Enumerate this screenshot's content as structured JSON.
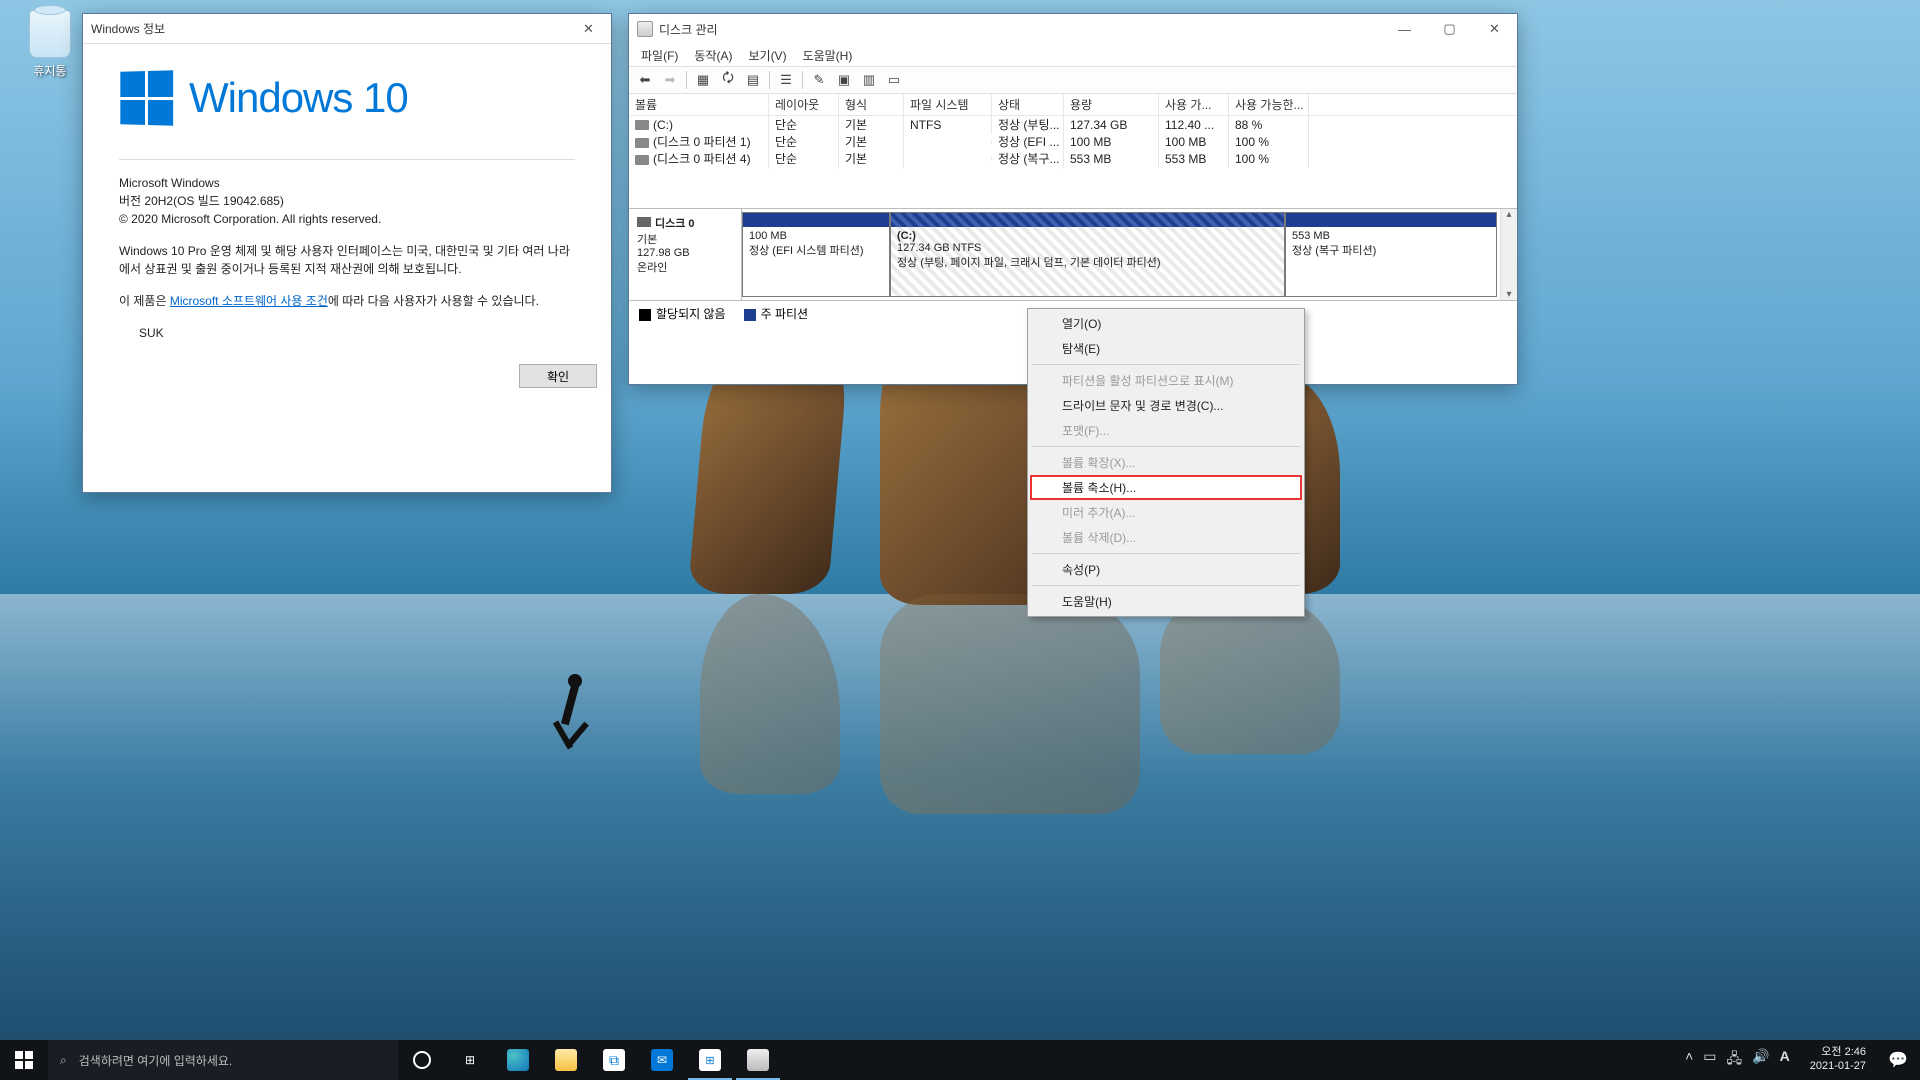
{
  "desktop": {
    "recycle_bin": "휴지통"
  },
  "winver": {
    "title": "Windows 정보",
    "logo_text": "Windows 10",
    "heading": "Microsoft Windows",
    "version": "버전 20H2(OS 빌드 19042.685)",
    "copyright": "© 2020 Microsoft Corporation. All rights reserved.",
    "para2": "Windows 10 Pro 운영 체제 및 해당 사용자 인터페이스는 미국, 대한민국 및 기타 여러 나라에서 상표권 및 출원 중이거나 등록된 지적 재산권에 의해 보호됩니다.",
    "para3_pre": "이 제품은 ",
    "para3_link": "Microsoft 소프트웨어 사용 조건",
    "para3_post": "에 따라 다음 사용자가 사용할 수 있습니다.",
    "user": "SUK",
    "ok": "확인"
  },
  "diskmgmt": {
    "title": "디스크 관리",
    "menus": [
      "파일(F)",
      "동작(A)",
      "보기(V)",
      "도움말(H)"
    ],
    "columns": {
      "vol": "볼륨",
      "layout": "레이아웃",
      "type": "형식",
      "fs": "파일 시스템",
      "status": "상태",
      "cap": "용량",
      "free": "사용 가...",
      "pct": "사용 가능한..."
    },
    "rows": [
      {
        "vol": "(C:)",
        "layout": "단순",
        "type": "기본",
        "fs": "NTFS",
        "status": "정상 (부팅...",
        "cap": "127.34 GB",
        "free": "112.40 ...",
        "pct": "88 %"
      },
      {
        "vol": "(디스크 0 파티션 1)",
        "layout": "단순",
        "type": "기본",
        "fs": "",
        "status": "정상 (EFI ...",
        "cap": "100 MB",
        "free": "100 MB",
        "pct": "100 %"
      },
      {
        "vol": "(디스크 0 파티션 4)",
        "layout": "단순",
        "type": "기본",
        "fs": "",
        "status": "정상 (복구...",
        "cap": "553 MB",
        "free": "553 MB",
        "pct": "100 %"
      }
    ],
    "disk": {
      "name": "디스크 0",
      "type": "기본",
      "size": "127.98 GB",
      "state": "온라인",
      "p1_line1": "100 MB",
      "p1_line2": "정상 (EFI 시스템 파티션)",
      "p2_line1": "(C:)",
      "p2_line2": "127.34 GB NTFS",
      "p2_line3": "정상 (부팅, 페이지 파일, 크래시 덤프, 기본 데이터 파티션)",
      "p3_line1": "553 MB",
      "p3_line2": "정상 (복구 파티션)"
    },
    "legend": {
      "unalloc": "할당되지 않음",
      "primary": "주 파티션"
    }
  },
  "ctx": {
    "open": "열기(O)",
    "explore": "탐색(E)",
    "mark_active": "파티션을 활성 파티션으로 표시(M)",
    "change_letter": "드라이브 문자 및 경로 변경(C)...",
    "format": "포맷(F)...",
    "extend": "볼륨 확장(X)...",
    "shrink": "볼륨 축소(H)...",
    "mirror": "미러 추가(A)...",
    "delete": "볼륨 삭제(D)...",
    "props": "속성(P)",
    "help": "도움말(H)"
  },
  "taskbar": {
    "search": "검색하려면 여기에 입력하세요.",
    "ime": "A",
    "time": "오전 2:46",
    "date": "2021-01-27"
  }
}
